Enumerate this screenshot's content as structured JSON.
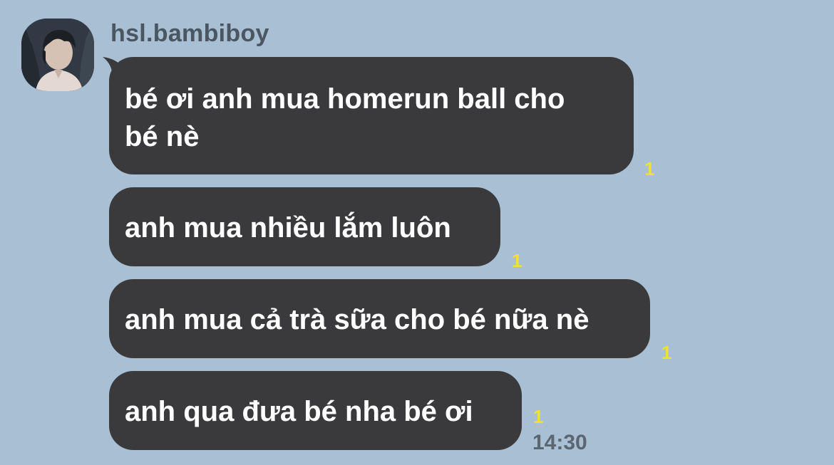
{
  "chat": {
    "sender_name": "hsl.bambiboy",
    "messages": [
      {
        "text_lines": [
          "bé ơi anh mua homerun ball cho",
          "bé nè"
        ],
        "unread": "1"
      },
      {
        "text_lines": [
          "anh mua nhiều lắm luôn"
        ],
        "unread": "1"
      },
      {
        "text_lines": [
          "anh mua cả trà sữa cho bé nữa nè"
        ],
        "unread": "1"
      },
      {
        "text_lines": [
          "anh qua đưa bé nha bé ơi"
        ],
        "unread": "1"
      }
    ],
    "last_time": "14:30"
  },
  "colors": {
    "background": "#a9bfd3",
    "bubble": "#3a3a3c",
    "bubble_text": "#ffffff",
    "unread": "#f1e03a",
    "sender_text": "#4b5663",
    "time_text": "#5a6672"
  },
  "icons": {
    "avatar": "profile-photo"
  }
}
